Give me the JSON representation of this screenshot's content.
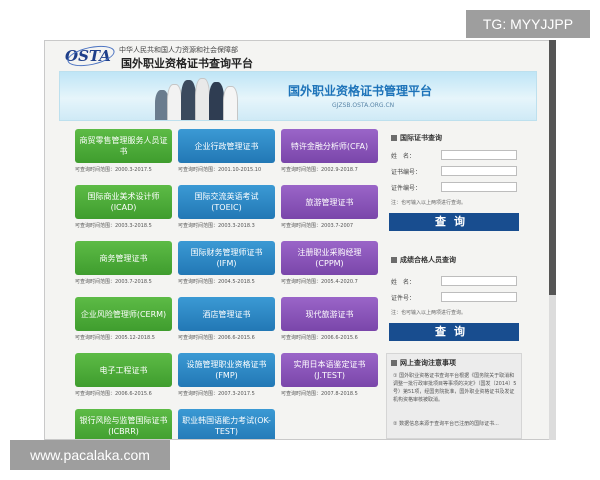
{
  "watermarks": {
    "telegram": "TG: MYYJJPP",
    "site": "www.pacalaka.com"
  },
  "header": {
    "logo_text": "OSTA",
    "gov_name": "中华人民共和国人力资源和社会保障部",
    "title": "国外职业资格证书查询平台"
  },
  "banner": {
    "title": "国外职业资格证书管理平台",
    "url": "GJZSB.OSTA.ORG.CN"
  },
  "certificates": [
    {
      "name": "商贸零售管理服务人员证书",
      "range": "可查询时间范围：2000.3-2017.5",
      "color": "green"
    },
    {
      "name": "企业行政管理证书",
      "range": "可查询时间范围：2001.10-2015.10",
      "color": "blue"
    },
    {
      "name": "特许金融分析师(CFA)",
      "range": "可查询时间范围：2002.9-2018.7",
      "color": "purple"
    },
    {
      "name": "国际商业美术设计师(ICAD)",
      "range": "可查询时间范围：2003.3-2018.5",
      "color": "green"
    },
    {
      "name": "国际交流英语考试(TOEIC)",
      "range": "可查询时间范围：2003.3-2018.3",
      "color": "blue"
    },
    {
      "name": "旅游管理证书",
      "range": "可查询时间范围：2003.7-2007",
      "color": "purple"
    },
    {
      "name": "商务管理证书",
      "range": "可查询时间范围：2003.7-2018.5",
      "color": "green"
    },
    {
      "name": "国际财务管理师证书(IFM)",
      "range": "可查询时间范围：2004.5-2018.5",
      "color": "blue"
    },
    {
      "name": "注册职业采购经理(CPPM)",
      "range": "可查询时间范围：2005.4-2020.7",
      "color": "purple"
    },
    {
      "name": "企业风险管理师(CERM)",
      "range": "可查询时间范围：2005.12-2018.5",
      "color": "green"
    },
    {
      "name": "酒店管理证书",
      "range": "可查询时间范围：2006.6-2015.6",
      "color": "blue"
    },
    {
      "name": "现代旅游证书",
      "range": "可查询时间范围：2006.6-2015.6",
      "color": "purple"
    },
    {
      "name": "电子工程证书",
      "range": "可查询时间范围：2006.6-2015.6",
      "color": "green"
    },
    {
      "name": "设施管理职业资格证书(FMP)",
      "range": "可查询时间范围：2007.3-2017.5",
      "color": "blue"
    },
    {
      "name": "实用日本语鉴定证书(J.TEST)",
      "range": "可查询时间范围：2007.8-2018.5",
      "color": "purple"
    },
    {
      "name": "银行风险与监管国际证书(ICBRR)",
      "range": "",
      "color": "green"
    },
    {
      "name": "职业韩国语能力考试(OK-TEST)",
      "range": "",
      "color": "blue"
    }
  ],
  "cert_query": {
    "heading": "国际证书查询",
    "name_label": "姓　名：",
    "cert_no_label": "证书编号：",
    "id_label": "证件编号：",
    "note": "注：也可输入以上两项进行查询。",
    "button": "查询"
  },
  "candidate_query": {
    "heading": "成绩合格人员查询",
    "name_label": "姓　名：",
    "id_label": "证件号：",
    "note": "注：也可输入以上两项进行查询。",
    "button": "查询"
  },
  "notice": {
    "heading": "网上查询注意事项",
    "item_1": "① 国外职业资格证书查询平台根据《国务院关于取消和调整一批行政审批项目等事项的决定》（国发〔2014〕5号）第51项，经国务院批准，国外职业资格证书及发证机构资格审核被取消。",
    "item_2": "② 数据信息来源于查询平台已注册的国际证书..."
  }
}
